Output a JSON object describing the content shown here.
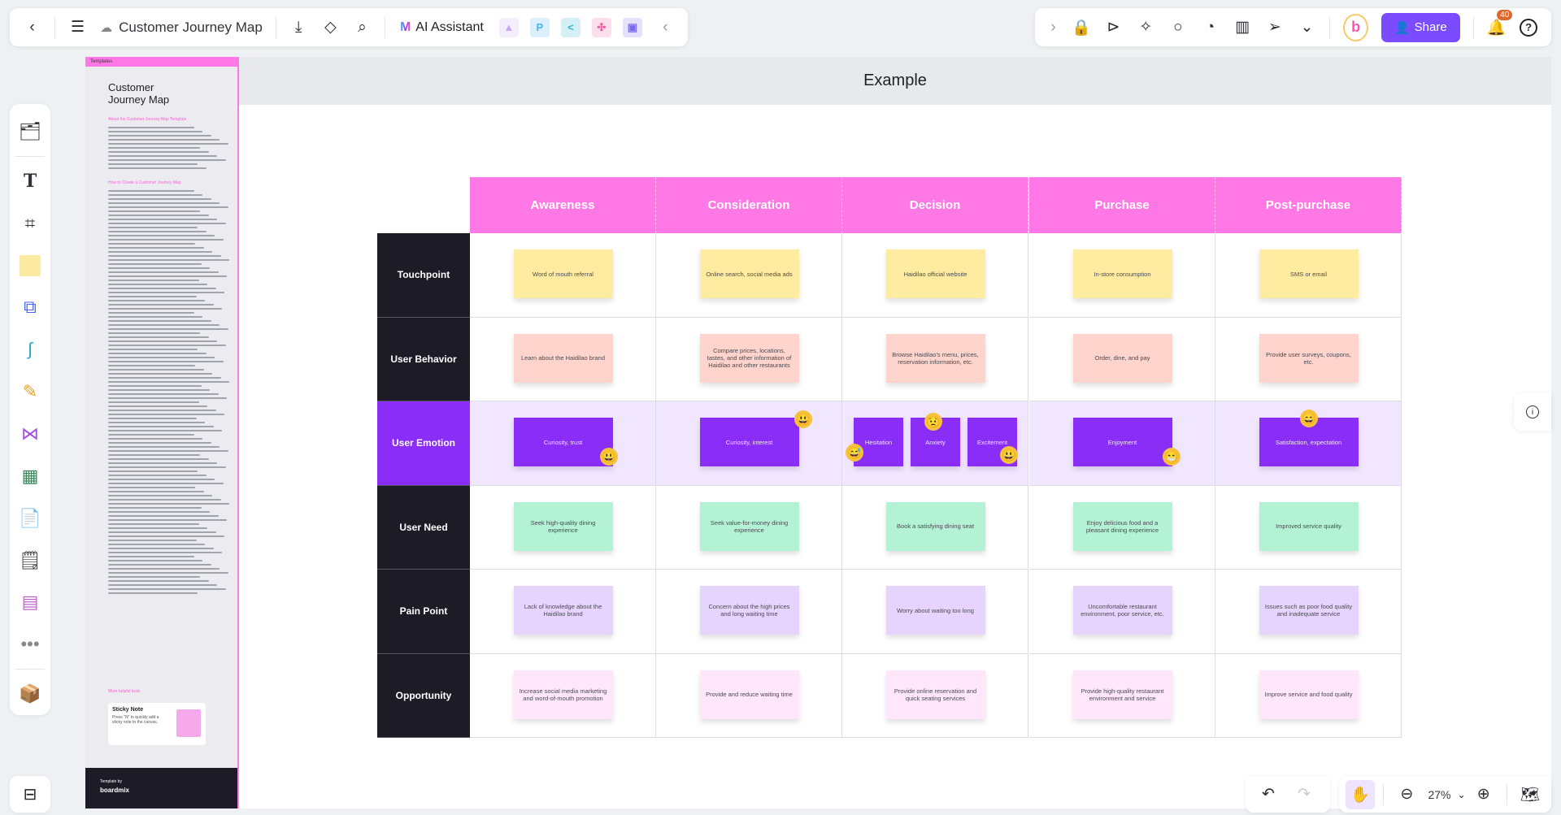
{
  "toolbar_left": {
    "back_icon": "chevron-left-icon",
    "menu_icon": "hamburger-icon",
    "cloud_icon": "cloud-saved-icon",
    "doc_title": "Customer Journey Map",
    "download_icon": "download-icon",
    "tag_icon": "tag-icon",
    "search_icon": "search-icon",
    "ai_label": "AI Assistant",
    "plugins": [
      {
        "name": "image-generator-plugin",
        "glyph": "▲",
        "color": "#c8a8f0"
      },
      {
        "name": "p-plugin",
        "glyph": "P",
        "color": "#49b6f0"
      },
      {
        "name": "share-node-plugin",
        "glyph": "<",
        "color": "#2fb6c8"
      },
      {
        "name": "mindmap-plugin",
        "glyph": "✣",
        "color": "#f05aa0"
      },
      {
        "name": "chat-plugin",
        "glyph": "▣",
        "color": "#7a6af0"
      }
    ],
    "collapse_icon": "chevron-left-icon"
  },
  "toolbar_right": {
    "expand_icon": "chevron-right-icon",
    "icons": [
      "locked-note-icon",
      "play-icon",
      "celebrate-icon",
      "comment-icon",
      "timer-icon",
      "vote-icon",
      "laser-pointer-icon",
      "more-chevrons-icon"
    ],
    "avatar_letter": "b",
    "share_label": "Share",
    "notifications_count": "40",
    "help_icon": "help-icon"
  },
  "rail": {
    "items": [
      "templates-icon",
      "text-icon",
      "frame-icon",
      "sticky-note-icon",
      "shape-icon",
      "connector-icon",
      "pen-icon",
      "mindmap-icon",
      "table-icon",
      "text-doc-icon",
      "card-icon",
      "kanban-icon",
      "more-icon",
      "resources-icon"
    ],
    "bottom": "minimap-location-icon"
  },
  "template_panel": {
    "header": "Templates",
    "title_line1": "Customer",
    "title_line2": "Journey Map",
    "section1": "About the Customer Journey Map Template",
    "section2": "How to Create a Customer Journey Map",
    "section3": "More helpful tools",
    "tool_title": "Sticky Note",
    "tool_desc": "Press \"N\" to quickly add a sticky note to the canvas.",
    "footer_label": "Template by",
    "footer_brand": "boardmix"
  },
  "canvas": {
    "frame_title": "Example"
  },
  "journey": {
    "stages": [
      "Awareness",
      "Consideration",
      "Decision",
      "Purchase",
      "Post-purchase"
    ],
    "rows": [
      {
        "label": "Touchpoint",
        "kind": "touch",
        "cells": [
          [
            "Word of mouth referral"
          ],
          [
            "Online search, social media ads"
          ],
          [
            "Haidilao official website"
          ],
          [
            "In-store consumption"
          ],
          [
            "SMS  or email"
          ]
        ]
      },
      {
        "label": "User  Behavior",
        "kind": "behavior",
        "cells": [
          [
            "Learn about the Haidilao brand"
          ],
          [
            "Compare prices, locations, tastes, and other information of Haidilao and other restaurants"
          ],
          [
            "Browse Haidilao's menu, prices, reservation information, etc."
          ],
          [
            "Order, dine, and pay"
          ],
          [
            "Provide  user surveys, coupons, etc."
          ]
        ]
      },
      {
        "label": "User  Emotion",
        "kind": "emotion",
        "cells": [
          [
            "Curiosity, trust"
          ],
          [
            "Curiosity, interest"
          ],
          [
            "Hesitation",
            "Anxiety",
            "Excitement"
          ],
          [
            "Enjoyment"
          ],
          [
            "Satisfaction, expectation"
          ]
        ]
      },
      {
        "label": "User  Need",
        "kind": "need",
        "cells": [
          [
            "Seek high-quality dining experience"
          ],
          [
            "Seek value-for-money dining experience"
          ],
          [
            "Book a satisfying dining seat"
          ],
          [
            "Enjoy delicious food and a pleasant dining experience"
          ],
          [
            "Improved service quality"
          ]
        ]
      },
      {
        "label": "Pain  Point",
        "kind": "pain",
        "cells": [
          [
            "Lack of knowledge about the Haidilao brand"
          ],
          [
            "Concern about the high prices and long waiting time"
          ],
          [
            "Worry about waiting too long"
          ],
          [
            "Uncomfortable restaurant environment, poor service, etc."
          ],
          [
            "Issues such as poor food quality and inadequate service"
          ]
        ]
      },
      {
        "label": "Opportunity",
        "kind": "opp",
        "cells": [
          [
            "Increase social media marketing and word-of-mouth promotion"
          ],
          [
            "Provide and reduce waiting time"
          ],
          [
            "Provide online reservation and quick seating services"
          ],
          [
            "Provide high-quality restaurant environment and service"
          ],
          [
            "Improve service and food quality"
          ]
        ]
      }
    ],
    "emotion_emojis": [
      {
        "stage": 0,
        "emoji": "😃",
        "name": "grinning-emoji"
      },
      {
        "stage": 1,
        "emoji": "😃",
        "name": "grinning-emoji"
      },
      {
        "stage": 2,
        "emoji": "😅",
        "name": "sweat-smile-emoji"
      },
      {
        "stage": 2,
        "emoji": "😟",
        "name": "worried-emoji"
      },
      {
        "stage": 2,
        "emoji": "😃",
        "name": "grinning-emoji"
      },
      {
        "stage": 3,
        "emoji": "😁",
        "name": "beaming-emoji"
      },
      {
        "stage": 4,
        "emoji": "😄",
        "name": "smile-emoji"
      }
    ],
    "colors": {
      "header": "#ff78e6",
      "label_bg": "#1c1b26",
      "emotion": "#8a2df7"
    }
  },
  "bottom": {
    "undo_icon": "undo-icon",
    "redo_icon": "redo-icon",
    "hand_icon": "hand-icon",
    "zoom_out_icon": "zoom-out-icon",
    "zoom_level": "27%",
    "zoom_in_icon": "zoom-in-icon",
    "map_icon": "map-icon"
  }
}
